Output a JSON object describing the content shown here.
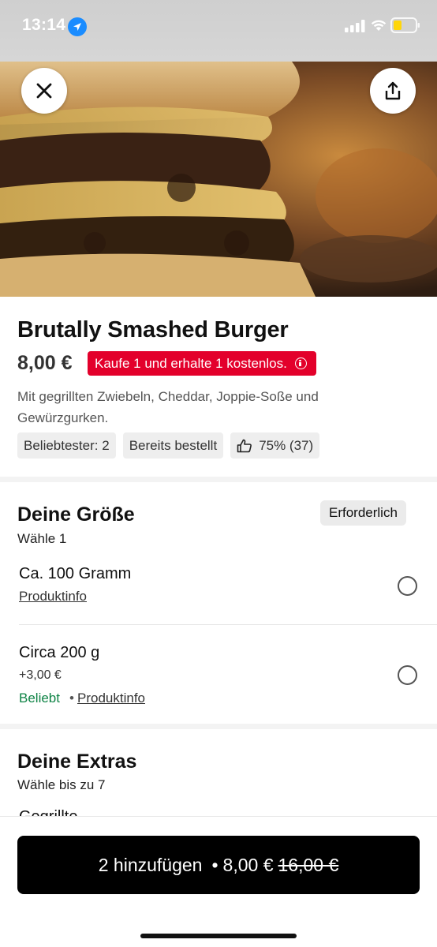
{
  "status_bar": {
    "time": "13:14",
    "icons": [
      "location-arrow-icon",
      "cellular-signal-icon",
      "wifi-icon",
      "battery-low-icon"
    ]
  },
  "header": {
    "close_icon": "close-icon",
    "share_icon": "share-icon"
  },
  "product": {
    "title": "Brutally Smashed Burger",
    "price": "8,00 €",
    "promo": "Kaufe 1 und erhalte 1 kostenlos.",
    "description": "Mit gegrillten Zwiebeln, Cheddar, Joppie-Soße und Gewürzgurken.",
    "chips": {
      "popular_rank": "Beliebtester: 2",
      "ordered": "Bereits bestellt",
      "rating": "75% (37)"
    }
  },
  "size_section": {
    "title": "Deine Größe",
    "subtitle": "Wähle 1",
    "required_badge": "Erforderlich",
    "options": [
      {
        "name": "Ca. 100 Gramm",
        "link": "Produktinfo"
      },
      {
        "name": "Circa 200 g",
        "extra_price": "+3,00 €",
        "popular": "Beliebt",
        "separator": "•",
        "link": "Produktinfo"
      }
    ]
  },
  "extras_section": {
    "title": "Deine Extras",
    "subtitle": "Wähle bis zu 7",
    "first_item_peek": "Gegrillte"
  },
  "add_button": {
    "label": "2 hinzufügen",
    "separator": "•",
    "price": "8,00 €",
    "original_price": "16,00 €"
  },
  "colors": {
    "promo_red": "#e3002b",
    "popular_green": "#0e8345",
    "button_black": "#000000"
  }
}
